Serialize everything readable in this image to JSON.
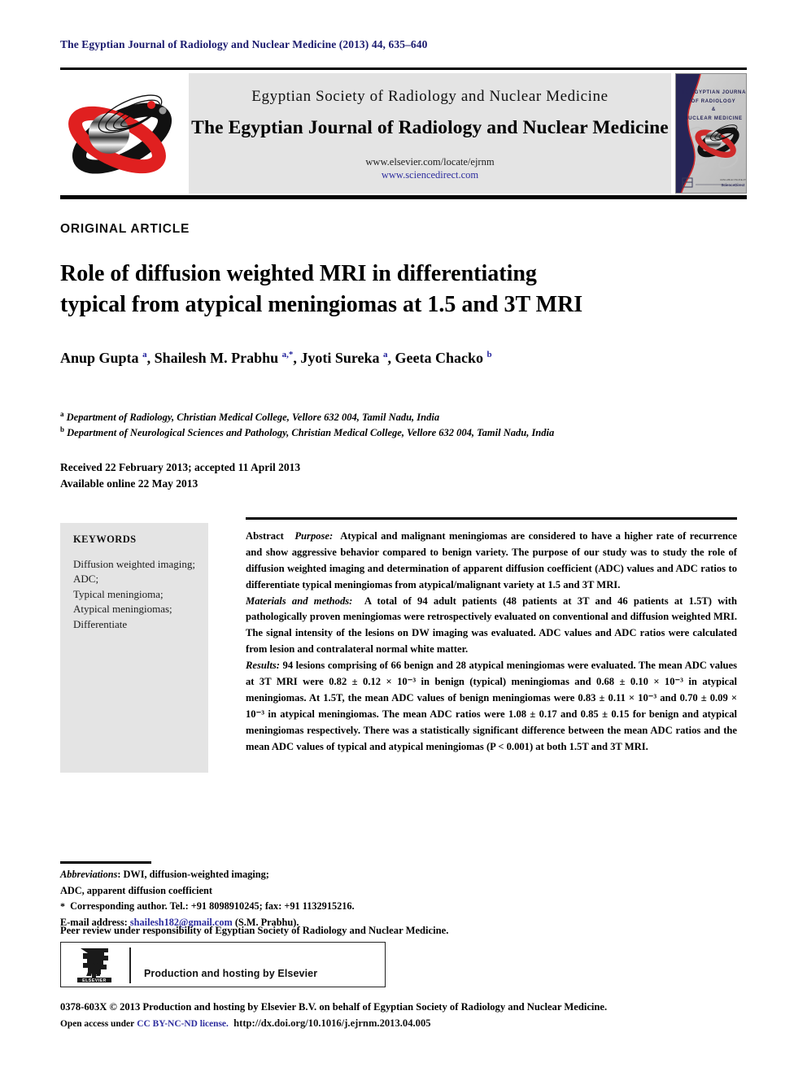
{
  "running_head": "The Egyptian Journal of Radiology and Nuclear Medicine (2013) 44, 635–640",
  "masthead": {
    "logo_icon": "journal-orbit-logo",
    "society_name": "Egyptian Society of Radiology and Nuclear Medicine",
    "journal_name": "The Egyptian Journal of Radiology and Nuclear Medicine",
    "url_elsevier": "www.elsevier.com/locate/ejrnm",
    "url_sciencedirect": "www.sciencedirect.com",
    "cover": {
      "line1": "THE EGYPTIAN JOURNAL",
      "line2": "OF RADIOLOGY",
      "line3": "&",
      "line4": "NUCLEAR MEDICINE"
    }
  },
  "article": {
    "section_label": "ORIGINAL ARTICLE",
    "title_line1": "Role of diffusion weighted MRI in differentiating",
    "title_line2": "typical from atypical meningiomas at 1.5 and 3T MRI",
    "authors_html": "Anup Gupta <sup>a</sup>, Shailesh M. Prabhu <sup>a,*</sup>, Jyoti Sureka <sup>a</sup>, Geeta Chacko <sup>b</sup>",
    "affiliation_a": "Department of Radiology, Christian Medical College, Vellore 632 004, Tamil Nadu, India",
    "affiliation_b": "Department of Neurological Sciences and Pathology, Christian Medical College, Vellore 632 004, Tamil Nadu, India",
    "received_line": "Received 22 February 2013; accepted 11 April 2013",
    "available_line": "Available online 22 May 2013"
  },
  "keywords": {
    "heading": "KEYWORDS",
    "items": [
      "Diffusion weighted imaging;",
      "ADC;",
      "Typical meningioma;",
      "Atypical meningiomas;",
      "Differentiate"
    ]
  },
  "abstract": {
    "label": "Abstract",
    "purpose_label": "Purpose:",
    "purpose_text": "Atypical and malignant meningiomas are considered to have a higher rate of recurrence and show aggressive behavior compared to benign variety. The purpose of our study was to study the role of diffusion weighted imaging and determination of apparent diffusion coefficient (ADC) values and ADC ratios to differentiate typical meningiomas from atypical/malignant variety at 1.5 and 3T MRI.",
    "methods_label": "Materials and methods:",
    "methods_text": "A total of 94 adult patients (48 patients at 3T and 46 patients at 1.5T) with pathologically proven meningiomas were retrospectively evaluated on conventional and diffusion weighted MRI. The signal intensity of the lesions on DW imaging was evaluated. ADC values and ADC ratios were calculated from lesion and contralateral normal white matter.",
    "results_label": "Results:",
    "results_text": "94 lesions comprising of 66 benign and 28 atypical meningiomas were evaluated. The mean ADC values at 3T MRI were 0.82 ± 0.12 × 10⁻³ in benign (typical) meningiomas and 0.68 ± 0.10 × 10⁻³ in atypical meningiomas. At 1.5T, the mean ADC values of benign meningiomas were 0.83 ± 0.11 × 10⁻³ and 0.70 ± 0.09 × 10⁻³ in atypical meningiomas. The mean ADC ratios were 1.08 ± 0.17 and 0.85 ± 0.15 for benign and atypical meningiomas respectively. There was a statistically significant difference between the mean ADC ratios and the mean ADC values of typical and atypical meningiomas (P < 0.001) at both 1.5T and 3T MRI."
  },
  "footnotes": {
    "abbrev_label": "Abbreviations",
    "abbrev_line1": ": DWI, diffusion-weighted imaging;",
    "abbrev_line2": "ADC, apparent diffusion coefficient",
    "corresponding": "Corresponding author. Tel.: +91 8098910245; fax: +91 1132915216.",
    "email_label": "E-mail address:",
    "email": "shailesh182@gmail.com",
    "email_suffix": "(S.M. Prabhu).",
    "peer_review": "Peer review under responsibility of Egyptian Society of Radiology and Nuclear Medicine."
  },
  "elsevier_box": {
    "logo_icon": "elsevier-tree-logo",
    "logo_caption": "ELSEVIER",
    "text": "Production and hosting by Elsevier"
  },
  "copyright": {
    "line1": "0378-603X © 2013 Production and hosting by Elsevier B.V. on behalf of Egyptian Society of Radiology and Nuclear Medicine.",
    "line2_prefix": "Open access under",
    "line2_license": "CC BY-NC-ND license.",
    "line2_doi": "http://dx.doi.org/10.1016/j.ejrnm.2013.04.005"
  },
  "colors": {
    "running_head": "#1a1a6e",
    "link_blue": "#2d2d9e",
    "panel_gray": "#e4e4e4",
    "logo_red": "#e02020"
  }
}
